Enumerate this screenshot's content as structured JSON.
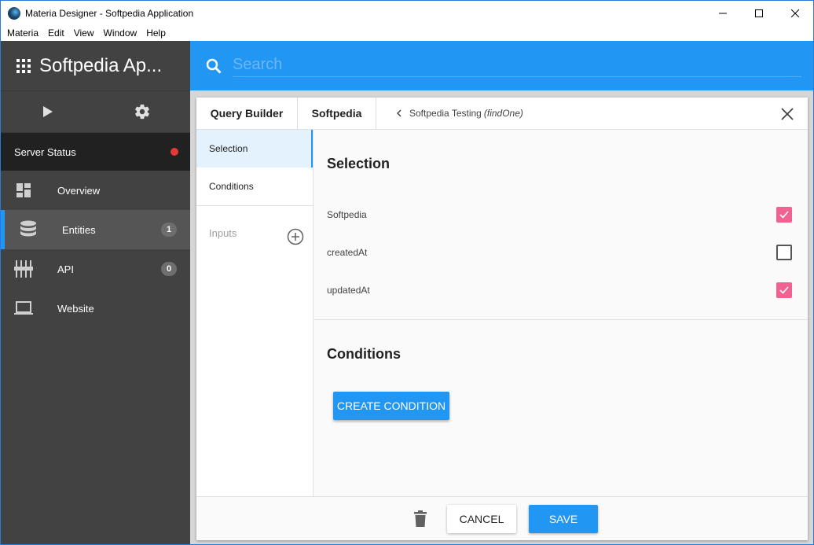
{
  "window": {
    "title": "Materia Designer - Softpedia Application"
  },
  "menu": [
    "Materia",
    "Edit",
    "View",
    "Window",
    "Help"
  ],
  "sidebar": {
    "app_title": "Softpedia Ap...",
    "server_status_label": "Server Status",
    "server_status_color": "#e53935",
    "items": [
      {
        "label": "Overview",
        "icon": "dashboard-icon",
        "badge": null
      },
      {
        "label": "Entities",
        "icon": "database-icon",
        "badge": "1",
        "active": true
      },
      {
        "label": "API",
        "icon": "api-icon",
        "badge": "0"
      },
      {
        "label": "Website",
        "icon": "laptop-icon",
        "badge": null
      }
    ]
  },
  "search": {
    "placeholder": "Search"
  },
  "panel": {
    "tab_query_builder": "Query Builder",
    "tab_entity": "Softpedia",
    "breadcrumb_name": "Softpedia Testing",
    "breadcrumb_method": "(findOne)",
    "side_tabs": [
      "Selection",
      "Conditions"
    ],
    "inputs_label": "Inputs",
    "selection_title": "Selection",
    "fields": [
      {
        "label": "Softpedia",
        "checked": true
      },
      {
        "label": "createdAt",
        "checked": false
      },
      {
        "label": "updatedAt",
        "checked": true
      }
    ],
    "conditions_title": "Conditions",
    "create_condition_label": "CREATE CONDITION",
    "cancel_label": "CANCEL",
    "save_label": "SAVE"
  },
  "colors": {
    "accent": "#2196f3",
    "checkbox": "#f06292",
    "sidebar": "#424242"
  }
}
